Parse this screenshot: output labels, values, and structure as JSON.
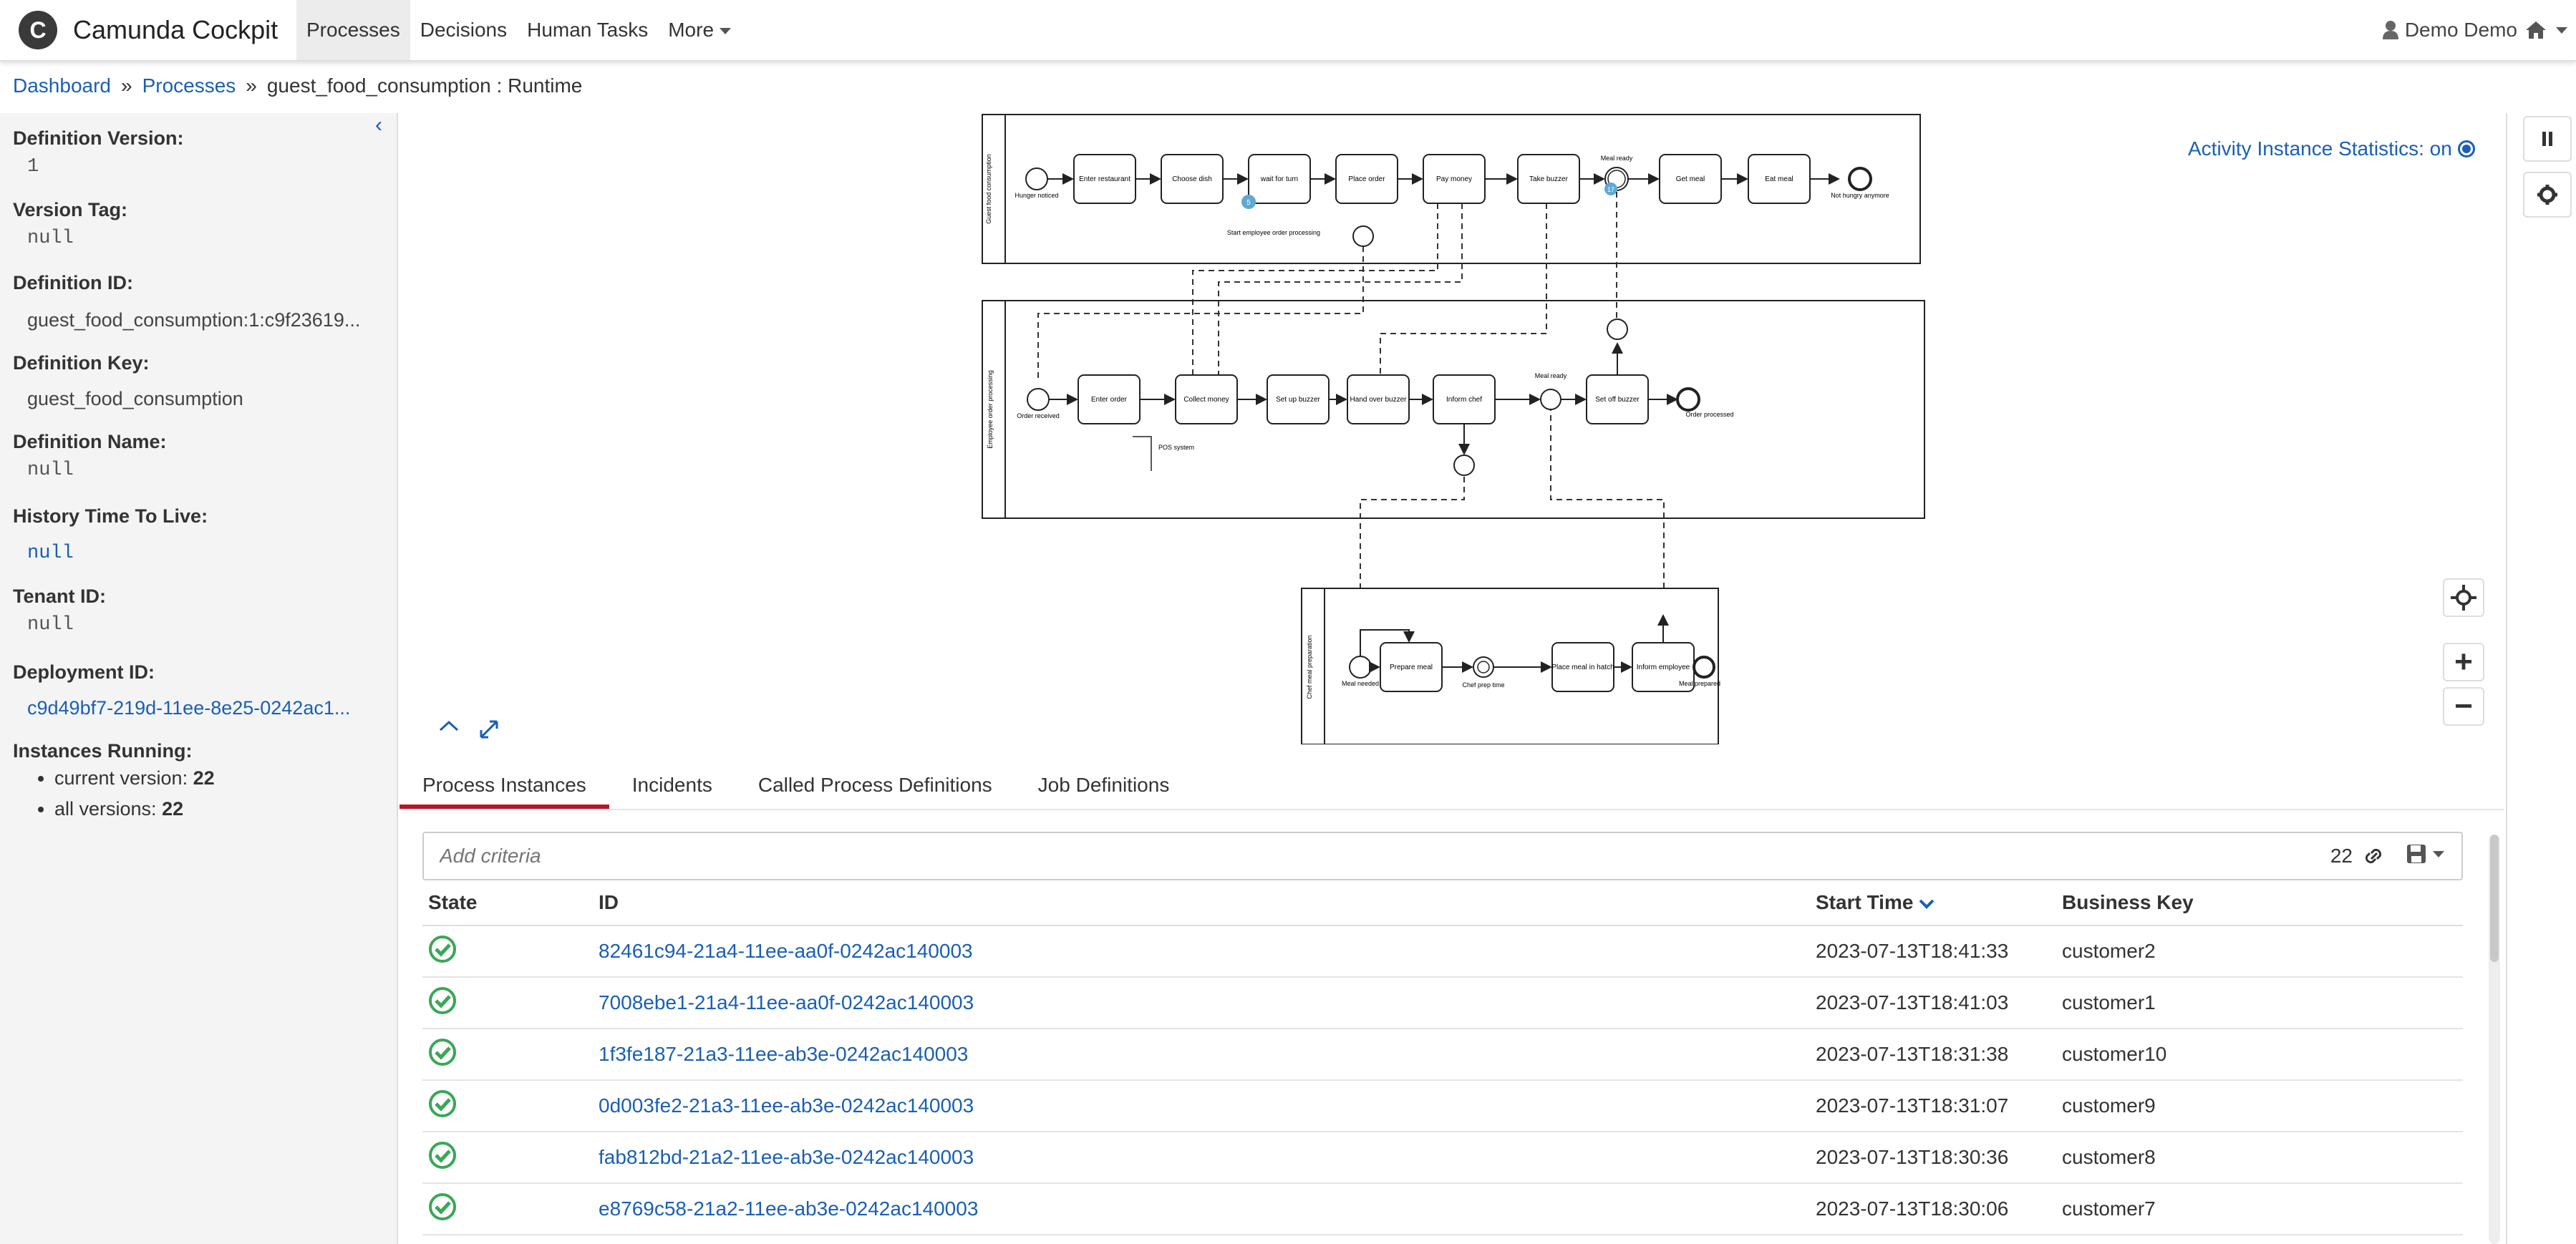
{
  "app": {
    "logo_letter": "C",
    "title": "Camunda Cockpit"
  },
  "nav": {
    "items": [
      {
        "label": "Processes",
        "active": true
      },
      {
        "label": "Decisions",
        "active": false
      },
      {
        "label": "Human Tasks",
        "active": false
      },
      {
        "label": "More",
        "active": false
      }
    ],
    "user": "Demo Demo"
  },
  "breadcrumb": {
    "dashboard": "Dashboard",
    "sep1": "»",
    "processes": "Processes",
    "sep2": "»",
    "current": "guest_food_consumption : Runtime"
  },
  "sidebar": {
    "definition_version": {
      "label": "Definition Version:",
      "value": "1"
    },
    "version_tag": {
      "label": "Version Tag:",
      "value": "null"
    },
    "definition_id": {
      "label": "Definition ID:",
      "value": "guest_food_consumption:1:c9f23619..."
    },
    "definition_key": {
      "label": "Definition Key:",
      "value": "guest_food_consumption"
    },
    "definition_name": {
      "label": "Definition Name:",
      "value": "null"
    },
    "history_ttl": {
      "label": "History Time To Live:",
      "value": "null"
    },
    "tenant_id": {
      "label": "Tenant ID:",
      "value": "null"
    },
    "deployment_id": {
      "label": "Deployment ID:",
      "value": "c9d49bf7-219d-11ee-8e25-0242ac1..."
    },
    "instances_running": {
      "label": "Instances Running:",
      "current_label": "current version:",
      "current_value": "22",
      "all_label": "all versions:",
      "all_value": "22"
    }
  },
  "diagram": {
    "stats_label": "Activity Instance Statistics: on",
    "pools": [
      {
        "name": "Guest\nfood consumption",
        "elements": [
          "Hunger noticed",
          "Enter restaurant",
          "Choose dish",
          "wait for turn",
          "Place order",
          "Pay money",
          "Take buzzer",
          "Meal ready",
          "Get meal",
          "Eat meal",
          "Not hungry anymore",
          "Start employee order processing"
        ],
        "badges": {
          "wait_for_turn": "5",
          "meal_ready": "17"
        }
      },
      {
        "name": "Employee\norder processing",
        "elements": [
          "Order received",
          "Enter order",
          "Collect money",
          "Set up buzzer",
          "Hand over buzzer",
          "Inform chef",
          "Meal ready",
          "Set off buzzer",
          "Order processed",
          "POS system"
        ]
      },
      {
        "name": "Chef\nmeal preparation",
        "elements": [
          "Meal needed",
          "Prepare meal",
          "Chef prep time",
          "Place meal in hatch",
          "Inform employee",
          "Meal prepared"
        ]
      }
    ]
  },
  "tabs": [
    "Process Instances",
    "Incidents",
    "Called Process Definitions",
    "Job Definitions"
  ],
  "search": {
    "placeholder": "Add criteria",
    "count": "22"
  },
  "table": {
    "headers": {
      "state": "State",
      "id": "ID",
      "start_time": "Start Time",
      "business_key": "Business Key"
    },
    "rows": [
      {
        "id": "82461c94-21a4-11ee-aa0f-0242ac140003",
        "start": "2023-07-13T18:41:33",
        "key": "customer2"
      },
      {
        "id": "7008ebe1-21a4-11ee-aa0f-0242ac140003",
        "start": "2023-07-13T18:41:03",
        "key": "customer1"
      },
      {
        "id": "1f3fe187-21a3-11ee-ab3e-0242ac140003",
        "start": "2023-07-13T18:31:38",
        "key": "customer10"
      },
      {
        "id": "0d003fe2-21a3-11ee-ab3e-0242ac140003",
        "start": "2023-07-13T18:31:07",
        "key": "customer9"
      },
      {
        "id": "fab812bd-21a2-11ee-ab3e-0242ac140003",
        "start": "2023-07-13T18:30:36",
        "key": "customer8"
      },
      {
        "id": "e8769c58-21a2-11ee-ab3e-0242ac140003",
        "start": "2023-07-13T18:30:06",
        "key": "customer7"
      }
    ]
  },
  "colors": {
    "link": "#1a5fb4",
    "active_tab": "#b5152b",
    "success": "#3aa757",
    "badge": "#5fa8d3"
  }
}
